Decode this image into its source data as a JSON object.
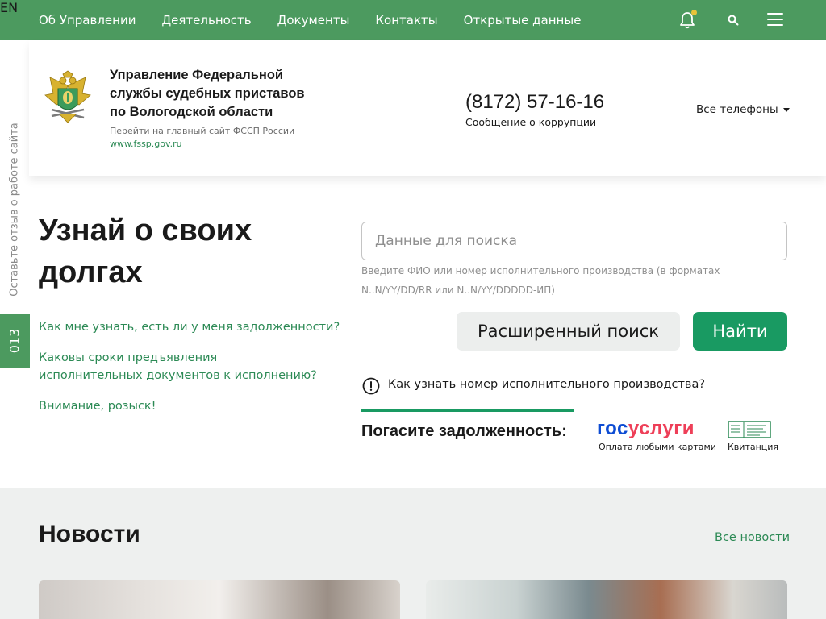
{
  "nav": {
    "items": [
      "Об Управлении",
      "Деятельность",
      "Документы",
      "Контакты",
      "Открытые данные"
    ],
    "lang": "EN"
  },
  "header": {
    "org_name": "Управление Федеральной службы судебных приставов по Вологодской области",
    "main_site_text": "Перейти на главный сайт ФССП России",
    "main_site_url": "www.fssp.gov.ru",
    "phone": "(8172) 57-16-16",
    "corruption_text": "Сообщение о коррупции",
    "all_phones": "Все телефоны"
  },
  "side": {
    "feedback": "Оставьте отзыв о работе сайта",
    "badge": "013"
  },
  "hero": {
    "title": "Узнай о своих долгах",
    "faq": [
      "Как мне узнать, есть ли у меня задолженности?",
      "Каковы сроки предъявления исполнительных документов к исполнению?",
      "Внимание, розыск!"
    ],
    "search_placeholder": "Данные для поиска",
    "search_hint": "Введите ФИО или номер исполнительного производства (в форматах N..N/YY/DD/RR или N..N/YY/DDDDD-ИП)",
    "advanced_search": "Расширенный поиск",
    "find": "Найти",
    "info_question": "Как узнать номер исполнительного производства?",
    "pay_label": "Погасите задолженность:",
    "gosuslugi_part1": "гос",
    "gosuslugi_part2": "услуги",
    "gosuslugi_caption": "Оплата любыми картами",
    "receipt_caption": "Квитанция"
  },
  "news": {
    "title": "Новости",
    "all": "Все новости"
  },
  "colors": {
    "brand_green": "#4c9a5f",
    "button_green": "#199a62",
    "link_green": "#2c8a55"
  }
}
